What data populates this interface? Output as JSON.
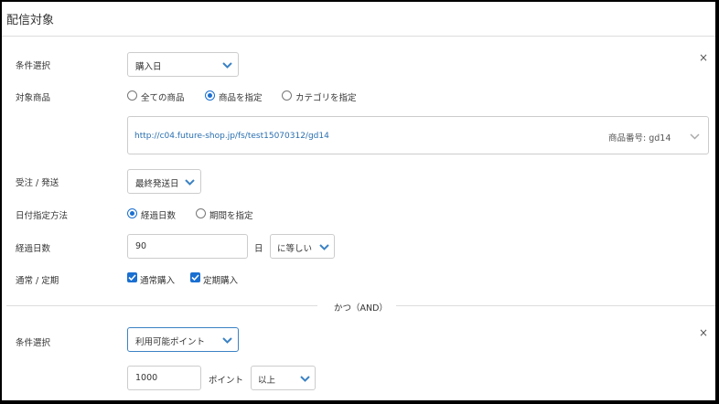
{
  "header": {
    "title": "配信対象"
  },
  "condition1": {
    "label": "条件選択",
    "select_value": "購入日",
    "remove_icon": "×"
  },
  "target_products": {
    "label": "対象商品",
    "options": [
      "全ての商品",
      "商品を指定",
      "カテゴリを指定"
    ],
    "selected": "商品を指定",
    "product_url": "http://c04.future-shop.jp/fs/test15070312/gd14",
    "product_code": "商品番号: gd14"
  },
  "order_shipping": {
    "label": "受注 / 発送",
    "select_value": "最終発送日"
  },
  "date_method": {
    "label": "日付指定方法",
    "options": [
      "経過日数",
      "期間を指定"
    ],
    "selected": "経過日数"
  },
  "elapsed_days": {
    "label": "経過日数",
    "value": "90",
    "unit": "日",
    "comparator": "に等しい"
  },
  "purchase_type": {
    "label": "通常 / 定期",
    "options": [
      "通常購入",
      "定期購入"
    ],
    "checked": [
      "通常購入",
      "定期購入"
    ]
  },
  "separator": {
    "text": "かつ（AND）"
  },
  "condition2": {
    "label": "条件選択",
    "select_value": "利用可能ポイント",
    "remove_icon": "×",
    "points_value": "1000",
    "points_unit": "ポイント",
    "comparator": "以上"
  },
  "colors": {
    "accent": "#1a6fd1",
    "link": "#2a6fb0",
    "border": "#cccccc"
  }
}
